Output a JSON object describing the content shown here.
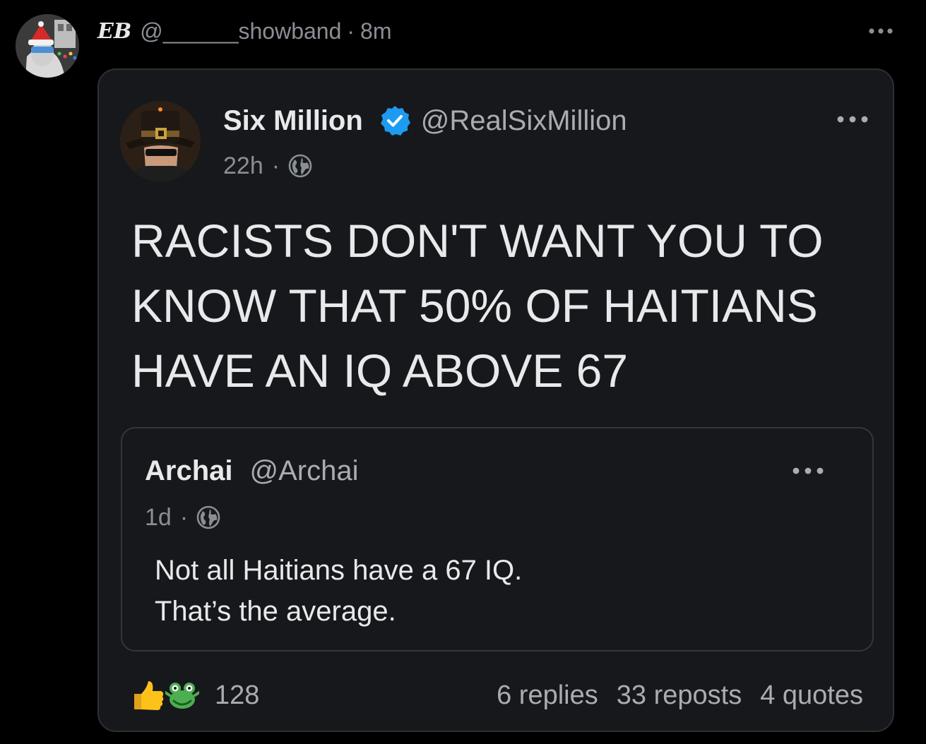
{
  "outer_post": {
    "author_name": "EB",
    "handle": "@______showband",
    "separator": "·",
    "time": "8m"
  },
  "quoted_post": {
    "author_name": "Six Million",
    "handle": "@RealSixMillion",
    "time": "22h",
    "separator": "·",
    "visibility_icon": "globe-icon",
    "verified_icon": "verified-badge-icon",
    "text": "RACISTS DON'T WANT YOU TO\nKNOW THAT 50% OF HAITIANS\nHAVE AN IQ ABOVE 67",
    "nested_quote": {
      "author_name": "Archai",
      "handle": "@Archai",
      "time": "1d",
      "separator": "·",
      "visibility_icon": "globe-icon",
      "text": "Not all Haitians have a 67 IQ.\nThat’s the average."
    },
    "footer": {
      "reaction_icons": [
        "thumbs-up-icon",
        "frog-emote-icon"
      ],
      "reaction_count": "128",
      "replies": "6 replies",
      "reposts": "33 reposts",
      "quotes": "4 quotes"
    }
  },
  "colors": {
    "background": "#000000",
    "card_background": "#16181c",
    "card_border": "#2c2f33",
    "primary_text": "#e7e9ea",
    "secondary_text": "#8b8f94",
    "verified_blue": "#1d9bf0"
  }
}
